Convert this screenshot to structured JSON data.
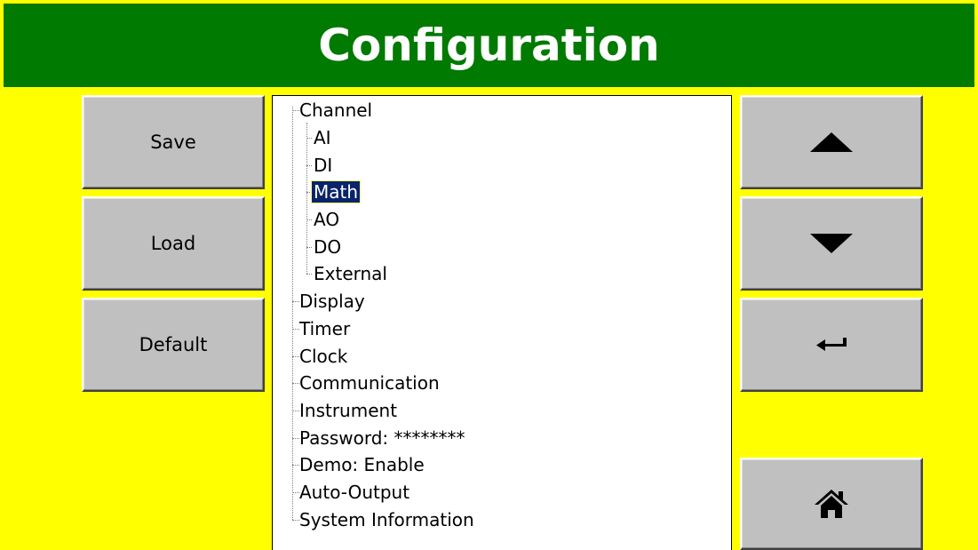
{
  "header": {
    "title": "Configuration"
  },
  "left_buttons": {
    "save": "Save",
    "load": "Load",
    "default": "Default"
  },
  "right_buttons": {
    "up_icon": "up-arrow-icon",
    "down_icon": "down-arrow-icon",
    "enter_icon": "enter-return-icon",
    "home_icon": "home-icon"
  },
  "tree": {
    "channel": {
      "label": "Channel",
      "children": [
        "AI",
        "DI",
        "Math",
        "AO",
        "DO",
        "External"
      ]
    },
    "items": [
      "Display",
      "Timer",
      "Clock",
      "Communication",
      "Instrument",
      "Password: ********",
      "Demo: Enable",
      "Auto-Output",
      "System Information"
    ],
    "selected": "Math"
  },
  "colors": {
    "background": "#ffff00",
    "header": "#007a00",
    "header_text": "#ffffff",
    "button": "#c0c0c0",
    "selection": "#0a246a"
  }
}
